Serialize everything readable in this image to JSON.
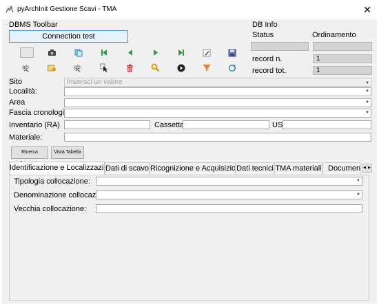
{
  "window": {
    "title": "pyArchInit Gestione Scavi - TMA",
    "close_glyph": "✕"
  },
  "dbms_toolbar": {
    "heading": "DBMS Toolbar",
    "connection_button": "Connection test",
    "row1_icons": [
      "blank-button-icon",
      "camera-icon",
      "copy-icon",
      "first-record-icon",
      "previous-record-icon",
      "next-record-icon",
      "last-record-icon",
      "edit-icon",
      "save-icon"
    ],
    "row2_icons": [
      "spellcheck-icon",
      "settings-icon",
      "spellcheck-icon",
      "cursor-icon",
      "delete-icon",
      "search-icon",
      "play-icon",
      "filter-icon",
      "refresh-icon"
    ]
  },
  "db_info": {
    "heading": "DB Info",
    "status_label": "Status",
    "ordinamento_label": "Ordinamento",
    "status_value": "",
    "ordinamento_value": "",
    "record_n_label": "record n.",
    "record_n_value": "1",
    "record_tot_label": "record tot.",
    "record_tot_value": "1"
  },
  "form": {
    "sito_label": "Sito",
    "sito_placeholder": "Inserisci un valore",
    "localita_label": "Località:",
    "area_label": "Area",
    "fascia_label": "Fascia cronologica:",
    "inventario_label": "Inventario (RA)",
    "cassetta_label": "Cassetta:",
    "us_label": "US",
    "materiale_label": "Materiale:"
  },
  "actions": {
    "ricerca_avanzata": "Ricerca Avanzata",
    "vista_tabella": "Vista Tabella"
  },
  "tabs": [
    {
      "label": "Identificazione e Localizzazione",
      "active": true
    },
    {
      "label": "Dati di scavo",
      "active": false
    },
    {
      "label": "Ricognizione e Acquisizione",
      "active": false
    },
    {
      "label": "Dati tecnici",
      "active": false
    },
    {
      "label": "TMA materiali",
      "active": false
    },
    {
      "label": "Documenta",
      "active": false
    }
  ],
  "tab_panel": {
    "tipologia_label": "Tipologia collocazione:",
    "denominazione_label": "Denominazione collocazione:",
    "vecchia_label": "Vecchia collocazione:"
  },
  "colors": {
    "accent": "#3c97d6",
    "window_bg": "#f0f0f0",
    "delete_red": "#e53935",
    "nav_green": "#2e9b3e",
    "filter_orange": "#f0772b"
  }
}
